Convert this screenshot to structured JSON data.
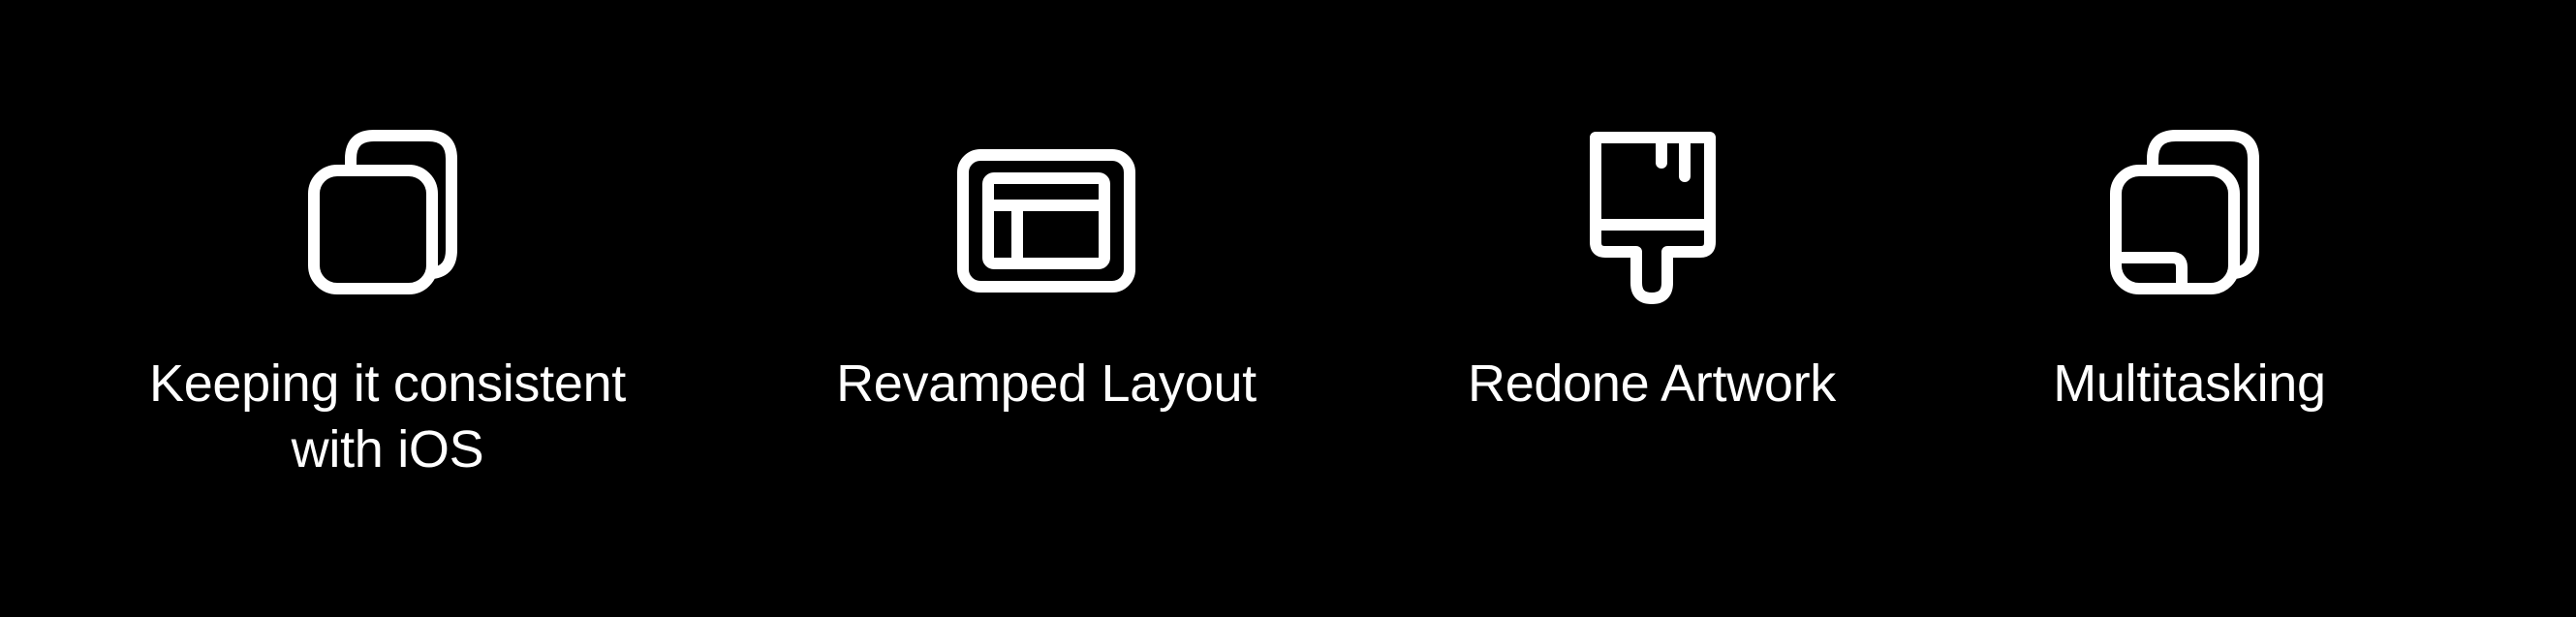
{
  "features": [
    {
      "label": "Keeping it consistent with iOS",
      "icon": "stacked-squares-icon"
    },
    {
      "label": "Revamped Layout",
      "icon": "layout-window-icon"
    },
    {
      "label": "Redone Artwork",
      "icon": "paintbrush-icon"
    },
    {
      "label": "Multitasking",
      "icon": "multitasking-windows-icon"
    }
  ],
  "colors": {
    "background": "#000000",
    "foreground": "#ffffff"
  }
}
